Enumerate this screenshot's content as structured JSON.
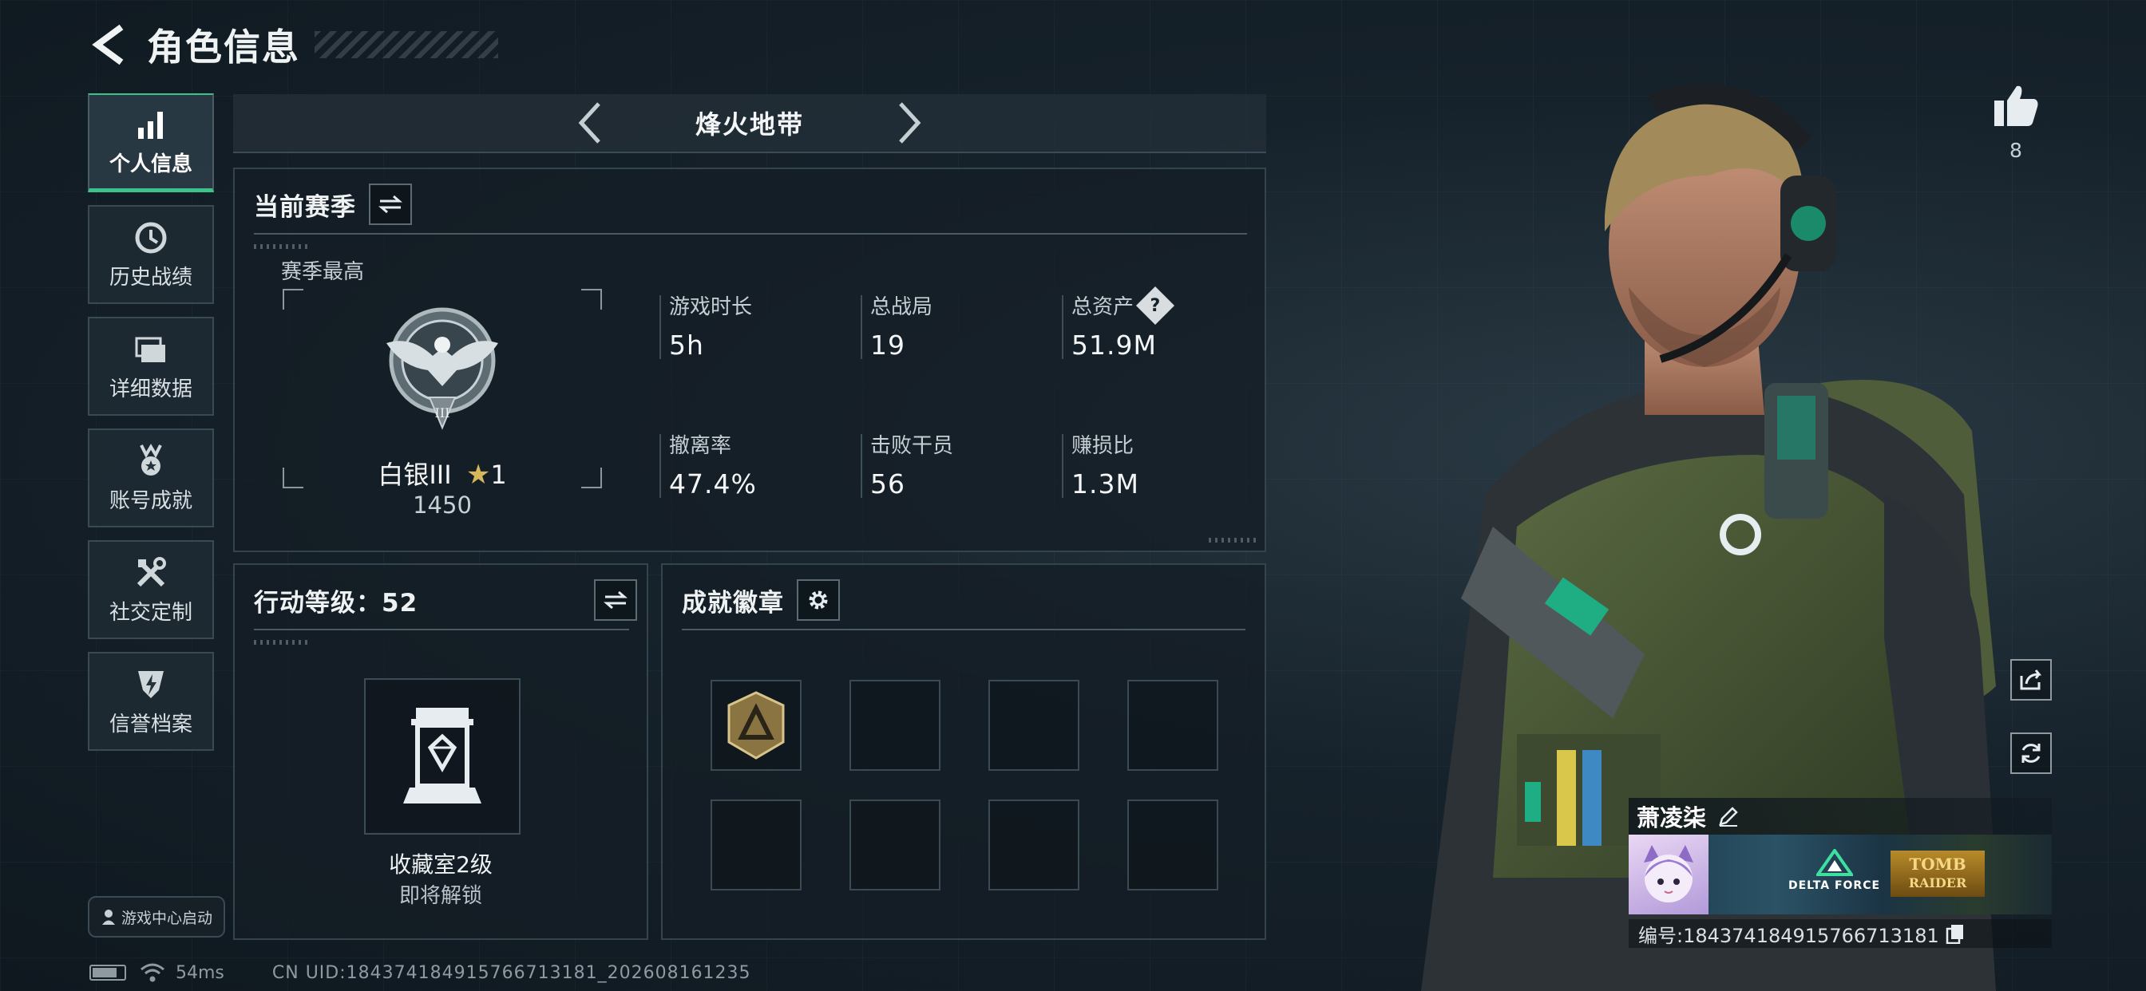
{
  "header": {
    "title": "角色信息"
  },
  "sidebar": {
    "items": [
      {
        "label": "个人信息",
        "icon": "bar-chart-icon",
        "active": true
      },
      {
        "label": "历史战绩",
        "icon": "history-clock-icon"
      },
      {
        "label": "详细数据",
        "icon": "folder-icon"
      },
      {
        "label": "账号成就",
        "icon": "medal-icon"
      },
      {
        "label": "社交定制",
        "icon": "tools-icon"
      },
      {
        "label": "信誉档案",
        "icon": "shield-bolt-icon"
      }
    ],
    "game_launch": "游戏中心启动"
  },
  "mode_selector": {
    "current": "烽火地带"
  },
  "season_panel": {
    "title": "当前赛季",
    "best_label": "赛季最高",
    "rank": {
      "name": "白银III",
      "stars": "1",
      "points": "1450",
      "tier_numeral": "III"
    },
    "stats": [
      {
        "label": "游戏时长",
        "value": "5h"
      },
      {
        "label": "总战局",
        "value": "19"
      },
      {
        "label": "总资产",
        "value": "51.9M",
        "help": "?"
      },
      {
        "label": "撤离率",
        "value": "47.4%"
      },
      {
        "label": "击败干员",
        "value": "56"
      },
      {
        "label": "赚损比",
        "value": "1.3M"
      }
    ]
  },
  "action_panel": {
    "title": "行动等级：52",
    "collection_label": "收藏室2级",
    "collection_status": "即将解锁"
  },
  "badges_panel": {
    "title": "成就徽章",
    "slots": 8
  },
  "profile": {
    "like_count": "8",
    "player_name": "萧凌柒",
    "banner_logo": "DELTA FORCE",
    "banner_tomb": "TOMB",
    "banner_raider": "RAIDER",
    "player_id": "编号:1843741849157667131​81"
  },
  "footer": {
    "ping": "54ms",
    "uid": "CN UID:18437418491576671​3181_202608161235"
  },
  "colors": {
    "accent": "#3cc38a",
    "text": "#e6ecef",
    "panel_border": "#34444e"
  }
}
